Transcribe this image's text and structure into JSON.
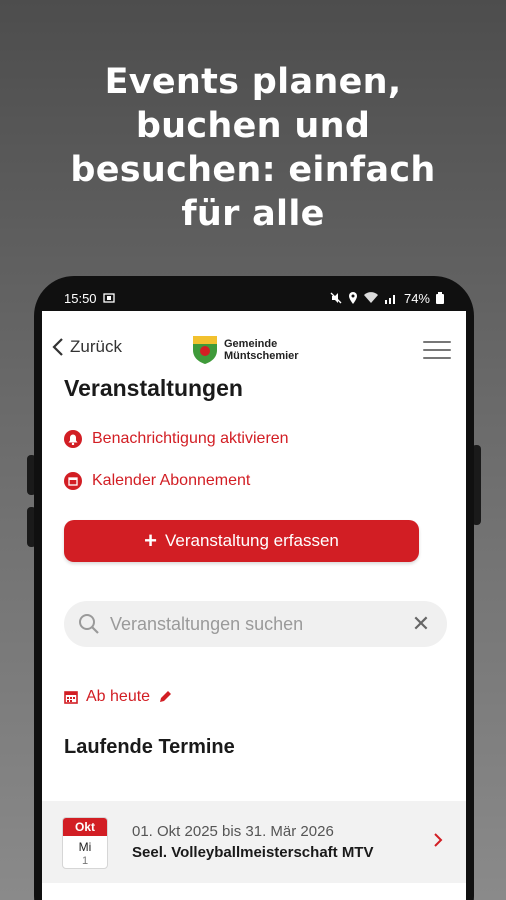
{
  "headline": {
    "line1": "Events planen,",
    "line2": "buchen und",
    "line3": "besuchen: einfach",
    "line4": "für alle"
  },
  "status_bar": {
    "time": "15:50",
    "battery": "74%"
  },
  "topbar": {
    "back_label": "Zurück",
    "logo_line1": "Gemeinde",
    "logo_line2": "Müntschemier",
    "menu_icon": "hamburger-icon"
  },
  "page": {
    "title": "Veranstaltungen",
    "notify_label": "Benachrichtigung aktivieren",
    "calendar_label": "Kalender Abonnement",
    "add_button_label": "Veranstaltung erfassen"
  },
  "search": {
    "placeholder": "Veranstaltungen suchen"
  },
  "filter": {
    "label": "Ab heute"
  },
  "section": {
    "title": "Laufende Termine"
  },
  "events": [
    {
      "month": "Okt",
      "weekday": "Mi",
      "day": "1",
      "date_range": "01. Okt 2025 bis 31. Mär 2026",
      "title": "Seel. Volleyballmeisterschaft MTV"
    }
  ],
  "colors": {
    "accent": "#d21e24",
    "background": "#6a6a6a"
  }
}
